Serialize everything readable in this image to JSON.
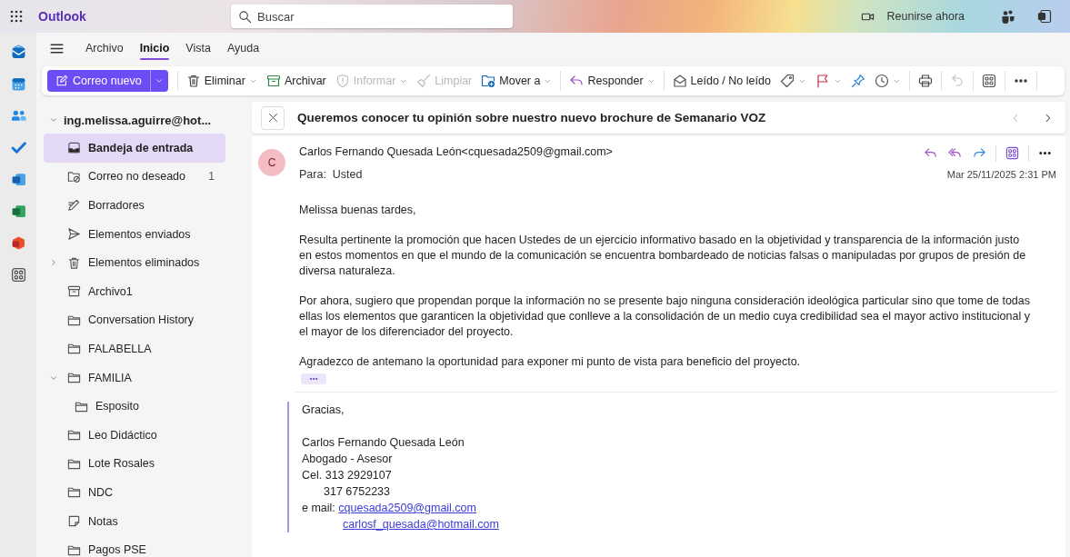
{
  "header": {
    "app_name": "Outlook",
    "search": {
      "placeholder": "Buscar"
    },
    "meet_now": "Reunirse ahora"
  },
  "menu_tabs": [
    {
      "label": "Archivo",
      "selected": false
    },
    {
      "label": "Inicio",
      "selected": true
    },
    {
      "label": "Vista",
      "selected": false
    },
    {
      "label": "Ayuda",
      "selected": false
    }
  ],
  "toolbar_groups": [
    [
      {
        "kind": "split",
        "label": "Correo nuevo"
      }
    ],
    [
      {
        "kind": "button",
        "label": "Eliminar",
        "dropdown": true,
        "disabled": false
      },
      {
        "kind": "button",
        "label": "Archivar",
        "dropdown": false,
        "disabled": false
      },
      {
        "kind": "button",
        "label": "Informar",
        "dropdown": true,
        "disabled": true
      },
      {
        "kind": "button",
        "label": "Limpiar",
        "dropdown": false,
        "disabled": true
      },
      {
        "kind": "button",
        "label": "Mover a",
        "dropdown": true,
        "disabled": false
      }
    ],
    [
      {
        "kind": "button",
        "label": "Responder",
        "dropdown": true,
        "disabled": false
      }
    ],
    [
      {
        "kind": "button",
        "label": "Leído / No leído",
        "dropdown": false,
        "disabled": false
      },
      {
        "kind": "icon",
        "dropdown": true,
        "disabled": false
      },
      {
        "kind": "icon",
        "dropdown": true,
        "disabled": false
      },
      {
        "kind": "icon",
        "dropdown": false,
        "disabled": false
      },
      {
        "kind": "icon",
        "dropdown": true,
        "disabled": false
      }
    ],
    [
      {
        "kind": "icon",
        "dropdown": false,
        "disabled": false
      }
    ],
    [
      {
        "kind": "icon",
        "dropdown": false,
        "disabled": true
      }
    ],
    [
      {
        "kind": "icon",
        "dropdown": false,
        "disabled": false
      }
    ],
    [
      {
        "kind": "icon",
        "dropdown": false,
        "disabled": false
      }
    ]
  ],
  "account": {
    "label": "ing.melissa.aguirre@hot...",
    "expanded": true,
    "folders": [
      {
        "label": "Bandeja de entrada",
        "selected": true
      },
      {
        "label": "Correo no deseado",
        "selected": false,
        "count": "1"
      },
      {
        "label": "Borradores",
        "selected": false
      },
      {
        "label": "Elementos enviados",
        "selected": false
      },
      {
        "label": "Elementos eliminados",
        "selected": false,
        "expanded": false
      },
      {
        "label": "Archivo1",
        "selected": false
      },
      {
        "label": "Conversation History",
        "selected": false
      },
      {
        "label": "FALABELLA",
        "selected": false
      },
      {
        "label": "FAMILIA",
        "selected": false,
        "expanded": true,
        "children": [
          {
            "label": "Esposito",
            "selected": false
          }
        ]
      },
      {
        "label": "Leo Didáctico",
        "selected": false
      },
      {
        "label": "Lote Rosales",
        "selected": false
      },
      {
        "label": "NDC",
        "selected": false
      },
      {
        "label": "Notas",
        "selected": false
      },
      {
        "label": "Pagos PSE",
        "selected": false
      }
    ]
  },
  "message": {
    "subject": "Queremos conocer tu opinión sobre nuestro nuevo brochure de Semanario VOZ",
    "avatar_initial": "C",
    "sender": "Carlos Fernando Quesada León<cquesada2509@gmail.com>",
    "to_label": "Para:",
    "to": "Usted",
    "date": "Mar 25/11/2025 2:31 PM",
    "body": [
      "Melissa buenas tardes,",
      "Resulta pertinente la promoción que hacen Ustedes de un ejercicio informativo basado en la objetividad y transparencia de la información justo en estos momentos en que el mundo de la comunicación se encuentra bombardeado de noticias falsas o manipuladas por grupos de presión de diversa naturaleza.",
      "Por ahora, sugiero que propendan porque la información no se presente bajo ninguna consideración ideológica particular sino que tome de todas ellas los elementos que garanticen la objetividad que conlleve a la consolidación de un medio cuya credibilidad sea el mayor activo institucional y el mayor de los diferenciador del proyecto.",
      "Agradezco de antemano la oportunidad para exponer mi punto de vista para beneficio del proyecto."
    ],
    "signature": {
      "closing": "Gracias,",
      "lines": [
        {
          "text": "Carlos Fernando Quesada León"
        },
        {
          "text": "Abogado - Asesor"
        },
        {
          "text": "Cel. 313 2929107"
        },
        {
          "text": "317 6752233",
          "indent": true
        },
        {
          "text": "e mail:",
          "link": "cquesada2509@gmail.com"
        },
        {
          "link": "carlosf_quesada@hotmail.com",
          "indent": true
        }
      ]
    }
  }
}
